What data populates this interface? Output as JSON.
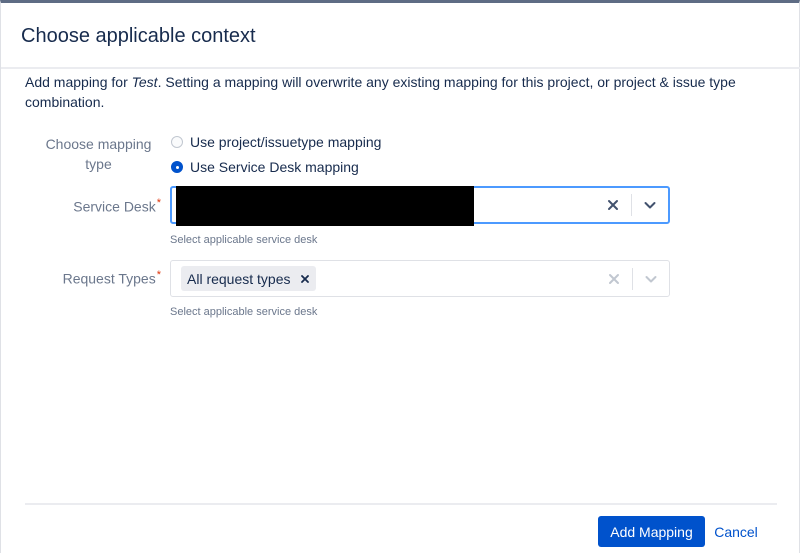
{
  "dialog": {
    "title": "Choose applicable context",
    "description_prefix": "Add mapping for ",
    "description_project": "Test",
    "description_suffix": ". Setting a mapping will overwrite any existing mapping for this project, or project & issue type combination."
  },
  "form": {
    "mapping_type": {
      "label": "Choose mapping type",
      "options": [
        {
          "label": "Use project/issuetype mapping",
          "selected": false
        },
        {
          "label": "Use Service Desk mapping",
          "selected": true
        }
      ]
    },
    "service_desk": {
      "label": "Service Desk",
      "required_marker": "*",
      "value": "",
      "helper": "Select applicable service desk"
    },
    "request_types": {
      "label": "Request Types",
      "required_marker": "*",
      "tags": [
        "All request types"
      ],
      "helper": "Select applicable service desk"
    }
  },
  "footer": {
    "primary_label": "Add Mapping",
    "cancel_label": "Cancel"
  },
  "colors": {
    "primary": "#0052cc",
    "focus_border": "#4c9aff",
    "required": "#de350b",
    "muted_text": "#6b778c"
  },
  "icons": [
    "clear-icon",
    "chevron-down-icon",
    "tag-remove-icon"
  ]
}
